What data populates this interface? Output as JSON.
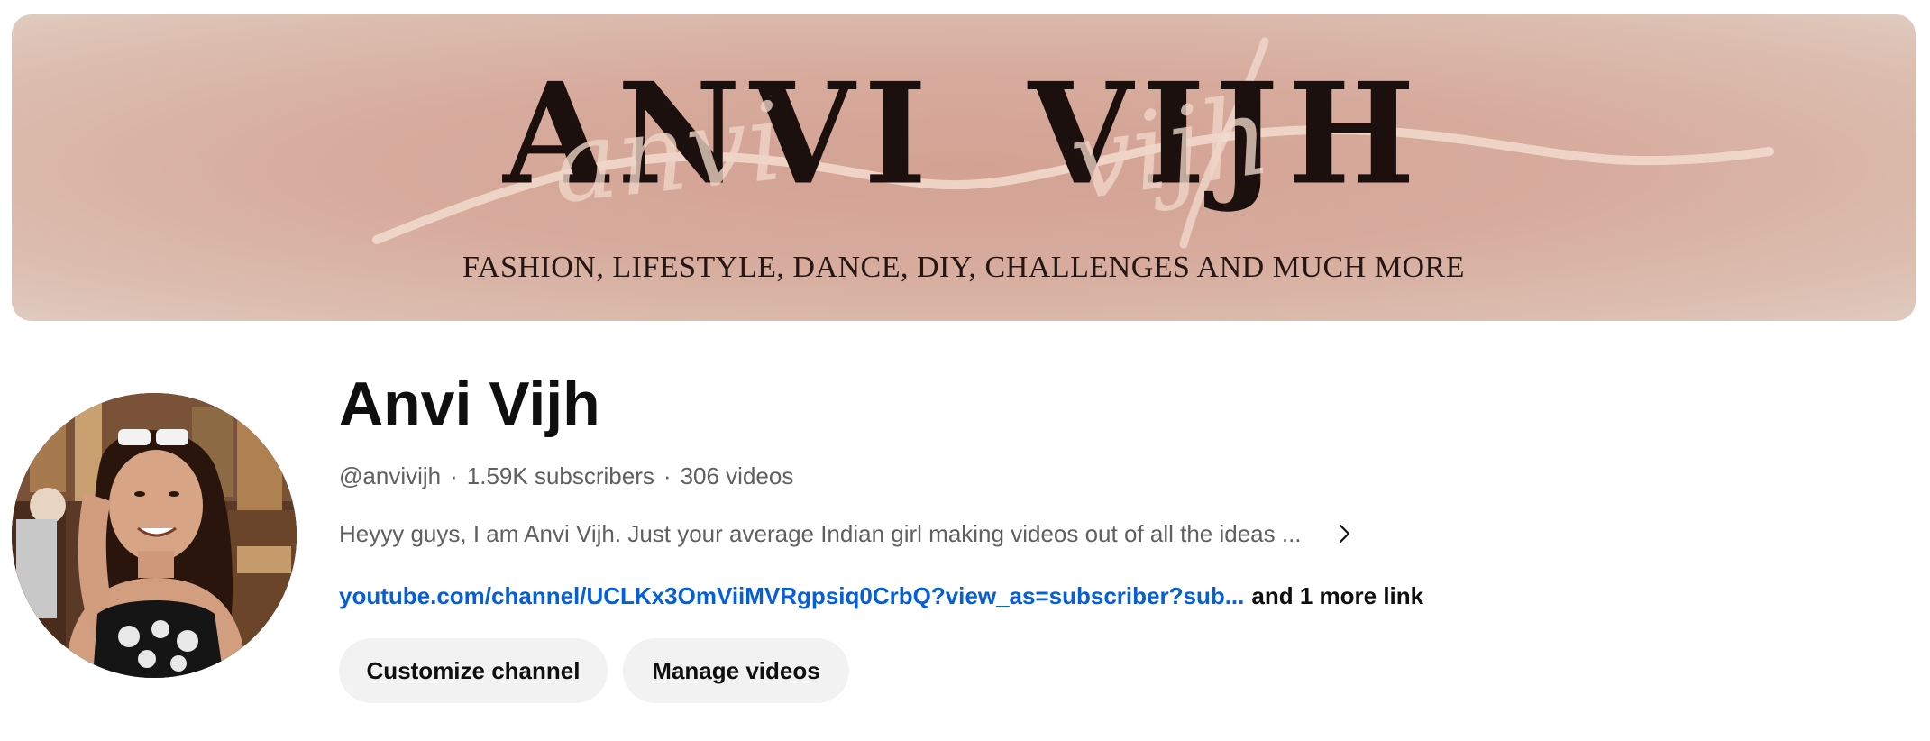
{
  "banner": {
    "title": "ANVI VIJH",
    "script_text_1": "anvi",
    "script_text_2": "vijh",
    "subtitle": "FASHION, LIFESTYLE, DANCE, DIY, CHALLENGES AND MUCH MORE"
  },
  "channel": {
    "name": "Anvi Vijh",
    "handle": "@anvivijh",
    "separator": "·",
    "subscribers": "1.59K subscribers",
    "videos": "306 videos",
    "description": "Heyyy guys, I am Anvi Vijh. Just your average Indian girl making videos out of all the ideas ...",
    "link_url": "youtube.com/channel/UCLKx3OmViiMVRgpsiq0CrbQ?view_as=subscriber?sub...",
    "link_more": "and 1 more link"
  },
  "actions": {
    "customize": "Customize channel",
    "manage": "Manage videos"
  },
  "colors": {
    "banner_center": "#d3a293",
    "banner_edge": "#e0cbbf",
    "link": "#065fd4",
    "button_bg": "#f2f2f2",
    "meta_text": "#606060"
  },
  "icons": {
    "description_expand": "chevron-right-icon"
  }
}
